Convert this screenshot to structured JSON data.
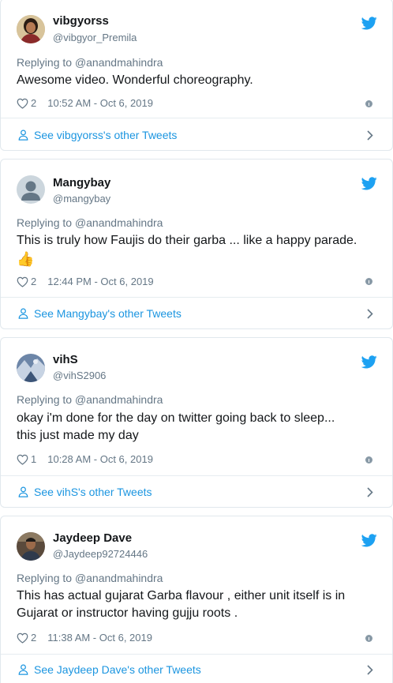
{
  "colors": {
    "link": "#1b95e0",
    "secondary": "#657786",
    "border": "#e1e8ed",
    "bird": "#1da1f2"
  },
  "tweets": [
    {
      "name": "vibgyorss",
      "handle": "@vibgyor_Premila",
      "replying_prefix": "Replying to ",
      "replying_to": "@anandmahindra",
      "text_lines": [
        "Awesome video. Wonderful choreography."
      ],
      "likes": "2",
      "timestamp": "10:52 AM - Oct 6, 2019",
      "see_more": "See vibgyorss's other Tweets",
      "avatar": "photo-woman"
    },
    {
      "name": "Mangybay",
      "handle": "@mangybay",
      "replying_prefix": "Replying to ",
      "replying_to": "@anandmahindra",
      "text_lines": [
        "This is truly how Faujis do their garba ... like a happy parade.",
        "👍"
      ],
      "likes": "2",
      "timestamp": "12:44 PM - Oct 6, 2019",
      "see_more": "See Mangybay's other Tweets",
      "avatar": "default-egg"
    },
    {
      "name": "vihS",
      "handle": "@vihS2906",
      "replying_prefix": "Replying to ",
      "replying_to": "@anandmahindra",
      "text_lines": [
        "okay i'm done for the day on twitter going back to sleep...",
        "this just made my day"
      ],
      "likes": "1",
      "timestamp": "10:28 AM - Oct 6, 2019",
      "see_more": "See vihS's other Tweets",
      "avatar": "photo-blue"
    },
    {
      "name": "Jaydeep Dave",
      "handle": "@Jaydeep92724446",
      "replying_prefix": "Replying to ",
      "replying_to": "@anandmahindra",
      "text_lines": [
        "This has actual gujarat Garba flavour , either unit itself is in",
        "Gujarat or instructor  having gujju roots ."
      ],
      "likes": "2",
      "timestamp": "11:38 AM - Oct 6, 2019",
      "see_more": "See Jaydeep Dave's other Tweets",
      "avatar": "photo-man"
    }
  ]
}
